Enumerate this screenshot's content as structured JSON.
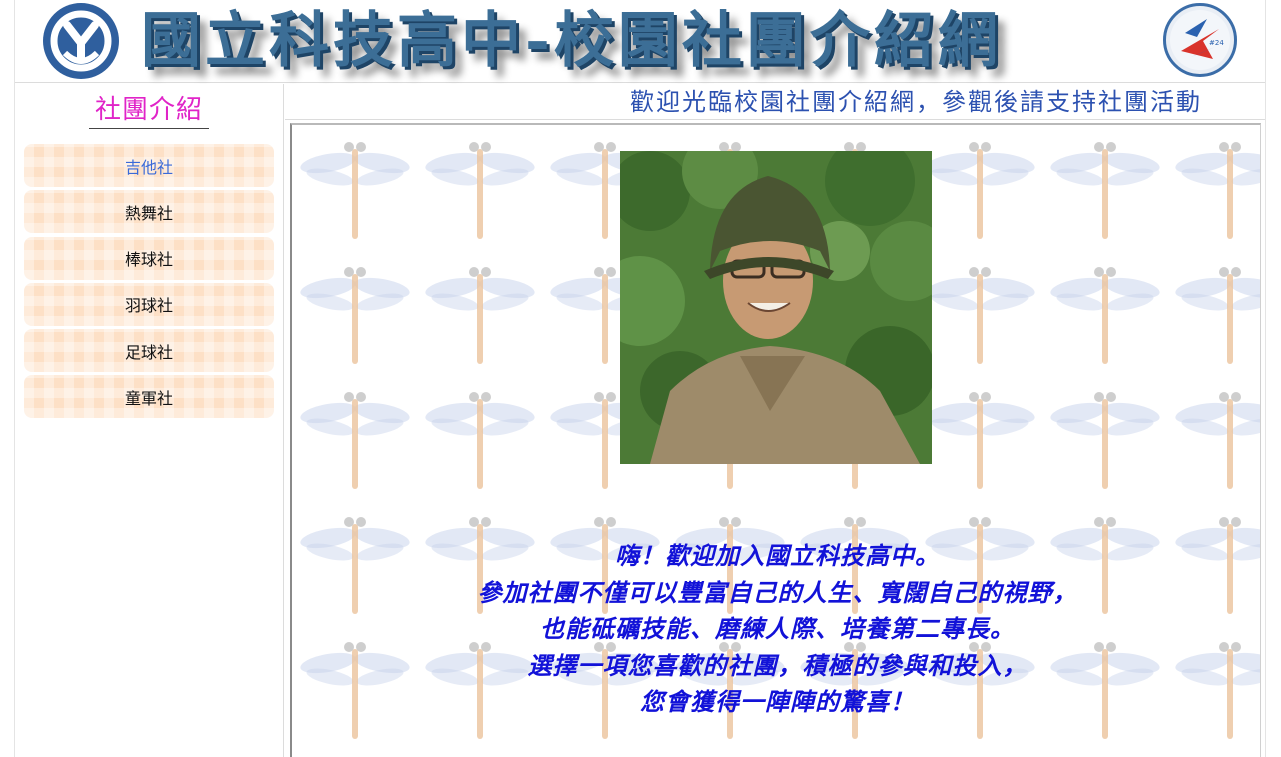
{
  "banner": {
    "title": "國立科技高中-校園社團介紹網",
    "left_logo_icon": "school-emblem-icon",
    "right_logo_icon": "star-badge-icon"
  },
  "sidebar": {
    "title": "社團介紹",
    "items": [
      {
        "label": "吉他社",
        "active": true
      },
      {
        "label": "熱舞社",
        "active": false
      },
      {
        "label": "棒球社",
        "active": false
      },
      {
        "label": "羽球社",
        "active": false
      },
      {
        "label": "足球社",
        "active": false
      },
      {
        "label": "童軍社",
        "active": false
      }
    ]
  },
  "marquee": {
    "text": "歡迎光臨校園社團介紹網，參觀後請支持社團活動"
  },
  "content": {
    "background_icon": "dragonfly-icon",
    "photo_icon": "portrait-photo-icon",
    "welcome_lines": [
      "嗨！歡迎加入國立科技高中。",
      "參加社團不僅可以豐富自己的人生、寬闊自己的視野，",
      "也能砥礪技能、磨練人際、培養第二專長。",
      "選擇一項您喜歡的社團，積極的參與和投入，",
      "您會獲得一陣陣的驚喜！"
    ]
  },
  "colors": {
    "sidebar_title": "#e024c8",
    "active_menu": "#3a6ad8",
    "menu_bg": "#fde0c6",
    "marquee_text": "#2c51b0",
    "welcome_text": "#1212d8"
  }
}
